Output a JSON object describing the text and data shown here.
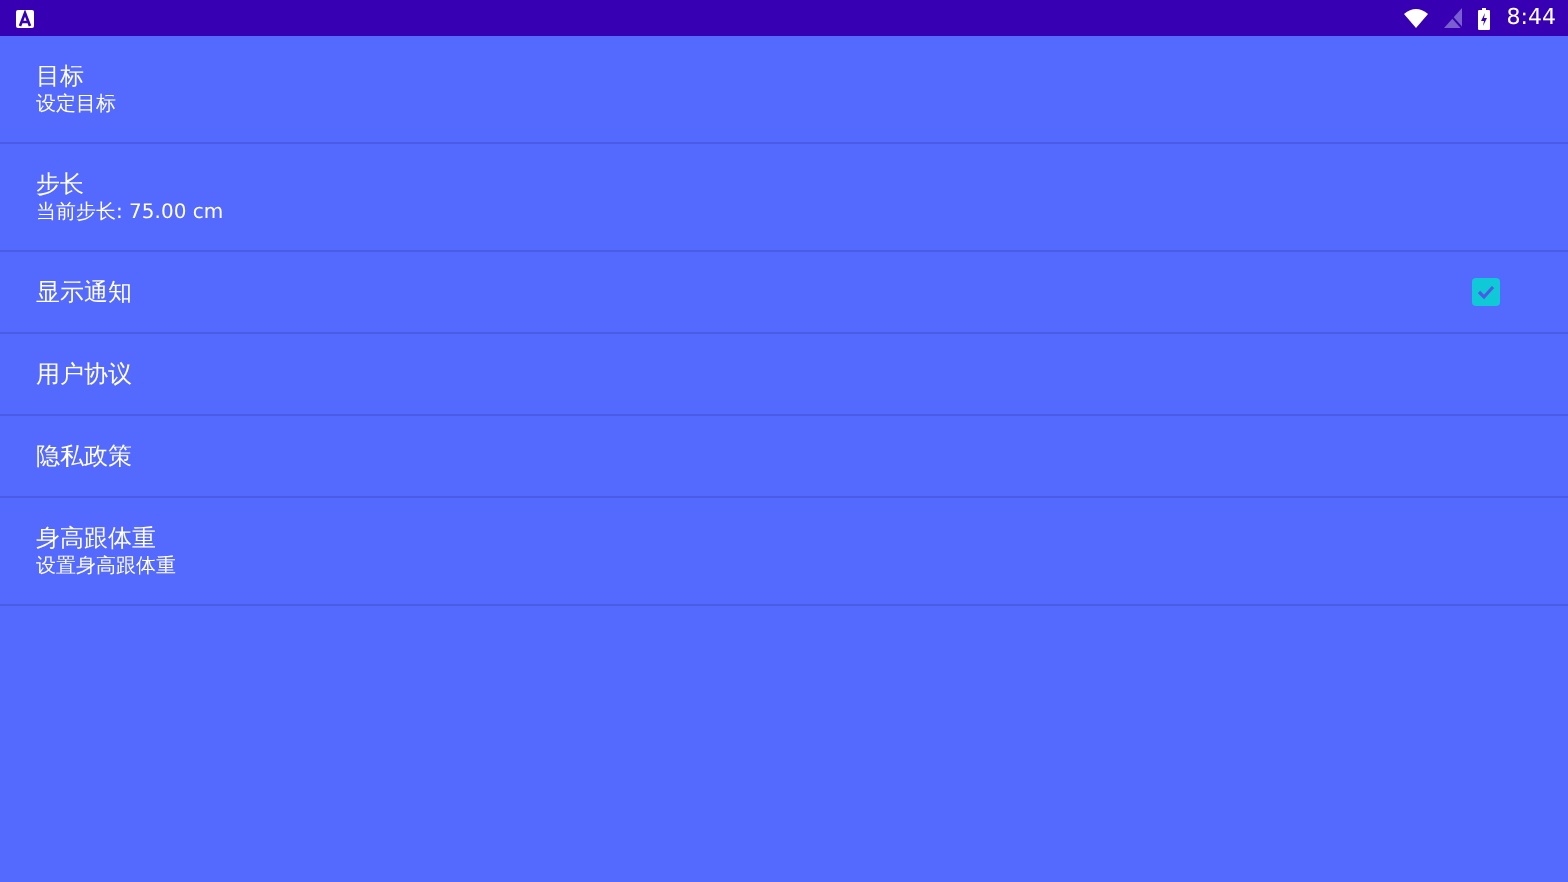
{
  "status_bar": {
    "time": "8:44"
  },
  "settings": [
    {
      "kind": "summary",
      "title": "目标",
      "summary": "设定目标"
    },
    {
      "kind": "summary",
      "title": "步长",
      "summary": "当前步长: 75.00 cm"
    },
    {
      "kind": "checkbox",
      "title": "显示通知",
      "checked": true
    },
    {
      "kind": "plain",
      "title": "用户协议"
    },
    {
      "kind": "plain",
      "title": "隐私政策"
    },
    {
      "kind": "summary",
      "title": "身高跟体重",
      "summary": "设置身高跟体重"
    }
  ]
}
